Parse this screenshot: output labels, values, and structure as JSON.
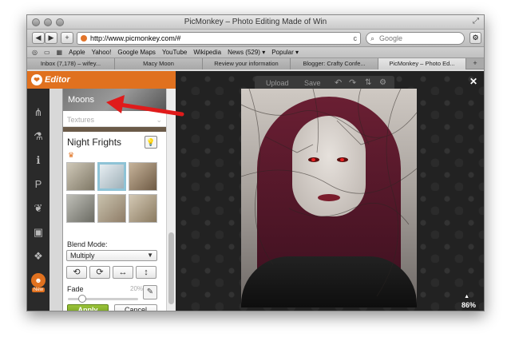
{
  "window": {
    "title": "PicMonkey – Photo Editing Made of Win",
    "resize_glyph": "⤢"
  },
  "toolbar": {
    "back_glyph": "◀",
    "forward_glyph": "▶",
    "add_glyph": "+",
    "url": "http://www.picmonkey.com/#",
    "reload_glyph": "c",
    "search_placeholder": "Google",
    "settings_glyph": "⚙"
  },
  "bookmarks": {
    "icons": [
      "reading-list-icon",
      "bookmarks-book-icon",
      "grid-icon"
    ],
    "items": [
      "Apple",
      "Yahoo!",
      "Google Maps",
      "YouTube",
      "Wikipedia",
      "News (529) ▾",
      "Popular ▾"
    ]
  },
  "tabs": {
    "items": [
      {
        "label": "Inbox (7,178) – wifey...",
        "active": false
      },
      {
        "label": "Macy Moon",
        "active": false
      },
      {
        "label": "Review your information",
        "active": false
      },
      {
        "label": "Blogger: Crafty Confe...",
        "active": false
      },
      {
        "label": "PicMonkey – Photo Ed...",
        "active": true
      }
    ],
    "add_glyph": "+"
  },
  "editor": {
    "logo_text": "Editor",
    "logo_glyph": "❤",
    "tools": [
      {
        "name": "basic-edits-icon",
        "glyph": "⋔"
      },
      {
        "name": "effects-icon",
        "glyph": "⚗"
      },
      {
        "name": "touch-up-icon",
        "glyph": "ℹ"
      },
      {
        "name": "text-icon",
        "glyph": "P"
      },
      {
        "name": "overlays-icon",
        "glyph": "❦"
      },
      {
        "name": "frames-icon",
        "glyph": "▣"
      },
      {
        "name": "textures-icon",
        "glyph": "❖"
      }
    ],
    "new_badge_glyph": "☻",
    "new_label": "New"
  },
  "panel": {
    "moons_label": "Moons",
    "textures_label": "Textures",
    "textures_chevron": "⌄",
    "section_title": "Night Frights",
    "crown_glyph": "♛",
    "bulb_glyph": "💡",
    "blend_label": "Blend Mode:",
    "blend_value": "Multiply",
    "select_chevron": "▼",
    "transform_buttons": [
      {
        "name": "rotate-left-button",
        "glyph": "⟲"
      },
      {
        "name": "rotate-right-button",
        "glyph": "⟳"
      },
      {
        "name": "flip-horizontal-button",
        "glyph": "↔"
      },
      {
        "name": "flip-vertical-button",
        "glyph": "↕"
      }
    ],
    "fade_label": "Fade",
    "fade_value": "20%",
    "fade_fraction": 0.2,
    "brush_glyph": "✎",
    "apply_label": "Apply",
    "cancel_label": "Cancel"
  },
  "action_bar": {
    "upload_label": "Upload",
    "save_label": "Save",
    "undo_glyph": "↶",
    "redo_glyph": "↷",
    "layers_glyph": "⇅",
    "settings_glyph": "⚙"
  },
  "canvas": {
    "close_glyph": "✕",
    "zoom_caret": "▲",
    "zoom_label": "86%"
  },
  "colors": {
    "accent_orange": "#e0711f",
    "apply_green": "#7aa528",
    "annotation_red": "#e01b1b"
  }
}
